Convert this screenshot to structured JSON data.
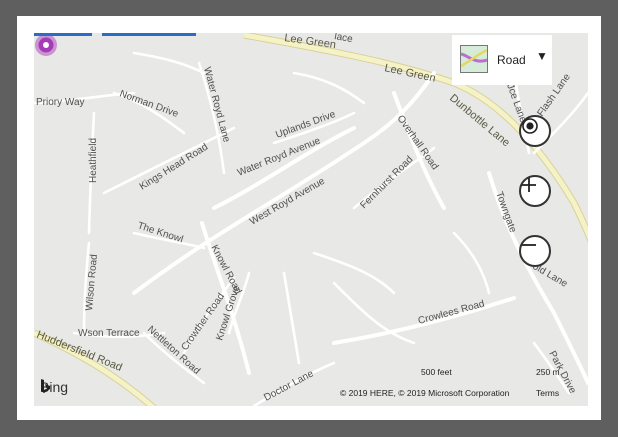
{
  "map": {
    "attribution": "© 2019 HERE, © 2019 Microsoft Corporation",
    "terms_label": "Terms",
    "logo_label": "Bing",
    "scale_imperial": "500 feet",
    "scale_metric": "250 m",
    "style_picker": {
      "label": "Road",
      "icon": "map-style-thumbnail-icon"
    },
    "controls": {
      "locate": "locate-me-icon",
      "zoom_in": "zoom-in-icon",
      "zoom_out": "zoom-out-icon"
    },
    "pin": {
      "icon": "location-pin-icon",
      "color": "#a040b0"
    },
    "colors": {
      "land": "#e8e8e6",
      "major_road": "#f6f2c7",
      "minor_road": "#ffffff",
      "pin": "#b04cc0"
    },
    "street_labels": {
      "lee_green_1": "Lee Green",
      "lee_green_2": "Lee Green",
      "lace": "lace",
      "priory_way": "Priory Way",
      "norman_drive": "Norman Drive",
      "water_royd_lane": "Water Royd Lane",
      "uplands_drive": "Uplands Drive",
      "overhall_road": "Overhall Road",
      "dunbottle_lane": "Dunbottle Lane",
      "jce_lane": "Jce Lane",
      "flash_lane": "Flash Lane",
      "heathfield": "Heathfield",
      "kings_head_road": "Kings Head Road",
      "water_royd_avenue": "Water Royd Avenue",
      "fernhurst_road": "Fernhurst Road",
      "west_royd_avenue": "West Royd Avenue",
      "towngate": "Towngate",
      "the_knowl": "The Knowl",
      "knowl_road": "Knowl Road",
      "wilson_road": "Wilson Road",
      "old_lane": "old Lane",
      "crowther_road": "Crowther Road",
      "knowl_grove": "Knowl Grove",
      "crowlees_road": "Crowlees Road",
      "wilson_terrace": "Wson Terrace",
      "nettleton_road": "Nettleton Road",
      "huddersfield_road": "Huddersfield Road",
      "doctor_lane": "Doctor Lane",
      "park_drive": "Park Drive"
    }
  }
}
